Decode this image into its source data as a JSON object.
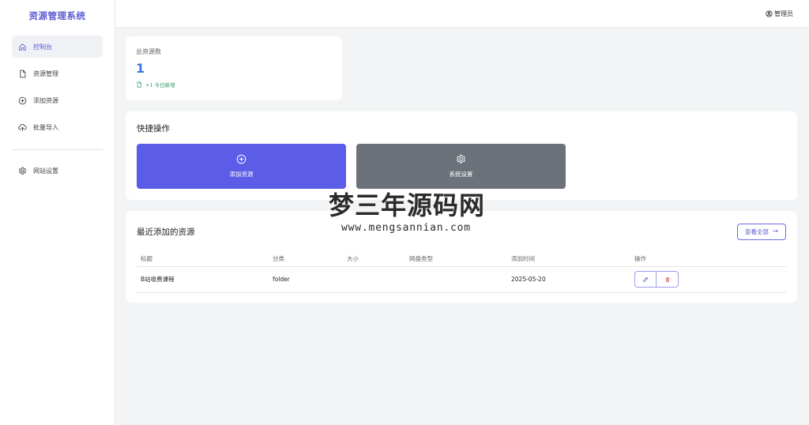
{
  "app": {
    "title": "资源管理系统"
  },
  "sidebar": {
    "items": [
      {
        "label": "控制台",
        "icon": "home-icon",
        "active": true
      },
      {
        "label": "资源管理",
        "icon": "file-icon"
      },
      {
        "label": "添加资源",
        "icon": "plus-circle-icon"
      },
      {
        "label": "批量导入",
        "icon": "cloud-upload-icon"
      }
    ],
    "bottom_items": [
      {
        "label": "网站设置",
        "icon": "gear-icon"
      }
    ]
  },
  "topbar": {
    "user_label": "管理员",
    "user_icon": "user-circle-icon"
  },
  "stats": {
    "label": "总资源数",
    "value": "1",
    "sub_label": "+1 今日新增",
    "sub_icon": "file-icon"
  },
  "quick_actions": {
    "title": "快捷操作",
    "buttons": [
      {
        "label": "添加资源",
        "icon": "plus-circle-icon",
        "color": "#5b5ce8"
      },
      {
        "label": "系统设置",
        "icon": "gear-icon",
        "color": "#6c727a"
      }
    ]
  },
  "recent": {
    "title": "最近添加的资源",
    "view_all_label": "查看全部",
    "view_all_arrow": "→",
    "columns": [
      "标题",
      "分类",
      "大小",
      "网盘类型",
      "添加时间",
      "操作"
    ],
    "rows": [
      {
        "title": "B站收费课程",
        "category": "folder",
        "size": "",
        "disk_type": "",
        "added": "2025-05-20"
      }
    ]
  },
  "watermark": {
    "main": "梦三年源码网",
    "sub": "www.mengsannian.com"
  },
  "colors": {
    "accent": "#5b5bd6",
    "primary_button": "#5b5ce8",
    "secondary_button": "#6c727a",
    "stat_value": "#3a77e0",
    "stat_sub": "#2e9a6a",
    "delete_icon": "#e05252"
  }
}
